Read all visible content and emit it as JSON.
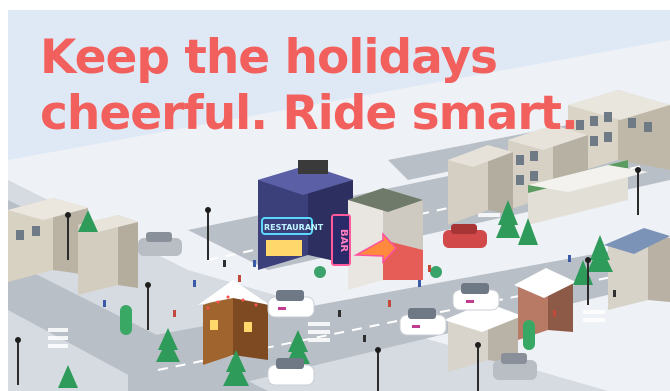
{
  "banner": {
    "headline_line1": "Keep the holidays",
    "headline_line2": "cheerful. Ride smart."
  },
  "signs": {
    "restaurant": "RESTAURANT",
    "bar": "BAR"
  },
  "colors": {
    "headline": "#f2605d",
    "sky": "#dfe9f6",
    "street": "#b9bfc7",
    "sidewalk": "#eef1f5",
    "car_accent": "#c23b8f",
    "tree": "#2f9b5b",
    "snow": "#ffffff"
  },
  "illustration": {
    "style": "isometric-city",
    "icons": [
      "car-icon",
      "tree-icon",
      "building-icon",
      "street-lamp-icon",
      "neon-sign-icon"
    ]
  }
}
